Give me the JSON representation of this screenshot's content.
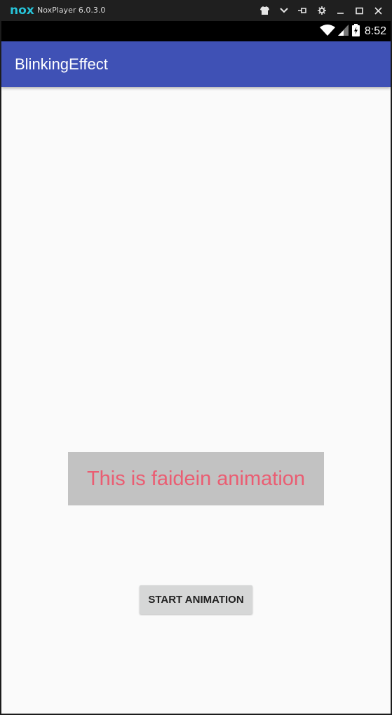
{
  "emulator": {
    "logo": "nox",
    "title": "NoxPlayer 6.0.3.0",
    "controls": [
      {
        "name": "shirt-icon",
        "glyph": "👕"
      },
      {
        "name": "chevron-down-icon",
        "glyph": "⌄"
      },
      {
        "name": "pin-icon",
        "glyph": "⊣"
      },
      {
        "name": "gear-icon",
        "glyph": "⚙"
      },
      {
        "name": "minimize-icon",
        "glyph": "—"
      },
      {
        "name": "maximize-icon",
        "glyph": "☐"
      },
      {
        "name": "close-icon",
        "glyph": "✕"
      }
    ]
  },
  "statusbar": {
    "time": "8:52",
    "icons": [
      "wifi-icon",
      "signal-icon",
      "battery-charging-icon"
    ]
  },
  "app": {
    "title": "BlinkingEffect",
    "accent_color": "#3f51b5"
  },
  "content": {
    "animated_text": "This is faidein animation",
    "animated_text_color": "#ea5d72",
    "start_button_label": "START ANIMATION"
  }
}
